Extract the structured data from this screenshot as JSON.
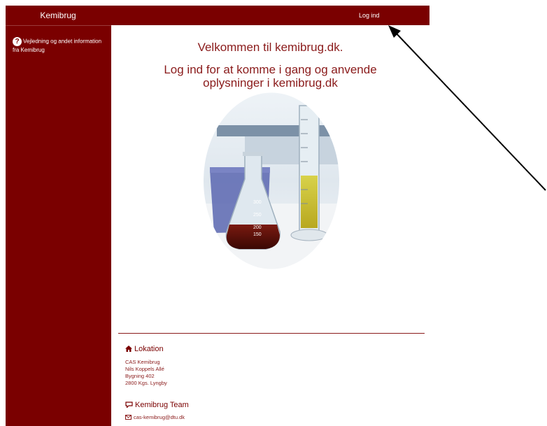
{
  "header": {
    "brand": "Kemibrug",
    "login_label": "Log ind"
  },
  "sidebar": {
    "items": [
      {
        "label": "Vejledning og andet information fra Kemibrug",
        "icon": "question-circle-icon"
      }
    ]
  },
  "main": {
    "welcome": "Velkommen til kemibrug.dk.",
    "subtitle": "Log ind for at komme i gang og anvende oplysninger i kemibrug.dk"
  },
  "footer": {
    "location": {
      "title": "Lokation",
      "icon": "home-icon",
      "lines": [
        "CAS Kemibrug",
        "Nils Koppels Allé",
        "Bygning 402",
        "2800 Kgs. Lyngby"
      ]
    },
    "team": {
      "title": "Kemibrug Team",
      "icon": "chat-icon",
      "email": "cas-kemibrug@dtu.dk",
      "email_icon": "envelope-icon"
    }
  },
  "colors": {
    "brand": "#7a0000",
    "text_accent": "#8a1a1a",
    "background": "#ffffff"
  }
}
